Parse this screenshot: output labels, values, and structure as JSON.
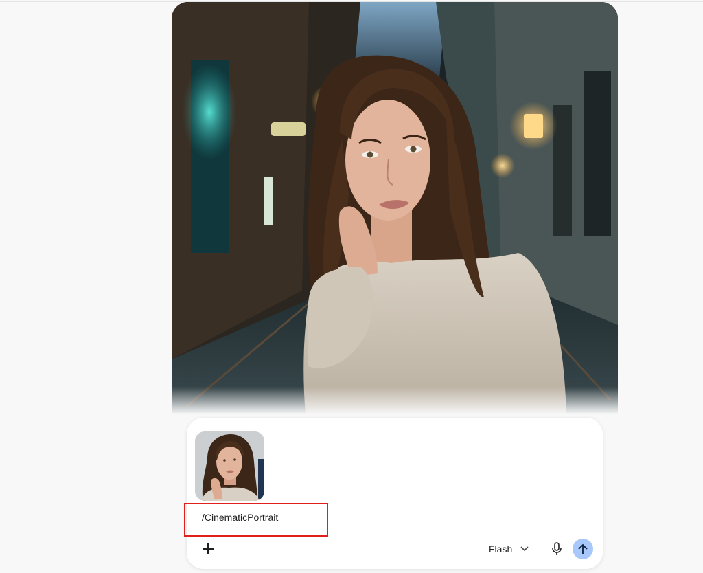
{
  "composer": {
    "prompt_text": "/CinematicPortrait",
    "model_label": "Flash",
    "icons": {
      "add": "plus-icon",
      "model_dropdown": "chevron-down-icon",
      "mic": "microphone-icon",
      "send": "arrow-up-icon"
    }
  },
  "colors": {
    "highlight_border": "#e0201c",
    "send_button_bg": "#a8c7fa",
    "composer_bg": "#ffffff",
    "page_bg": "#f8f8f8"
  }
}
